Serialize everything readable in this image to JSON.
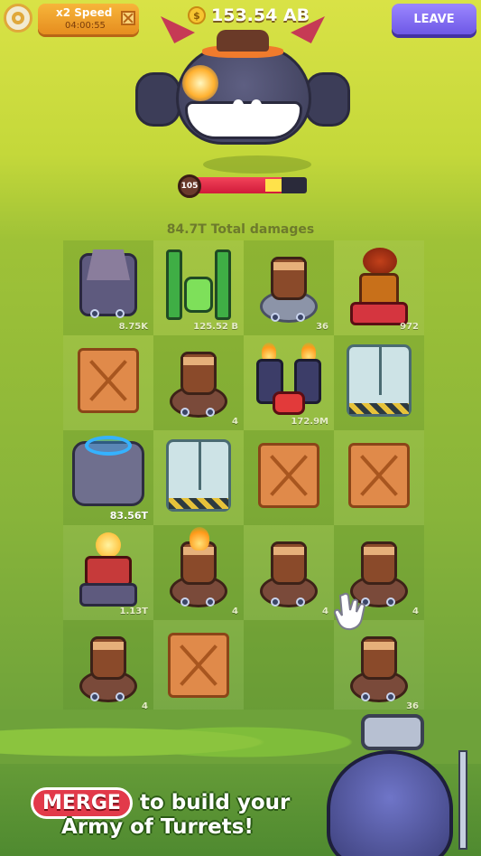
{
  "top_bar": {
    "settings_icon": "settings-gear-icon",
    "speed": {
      "title": "x2 Speed",
      "timer": "04:00:55"
    },
    "currency": {
      "coin_symbol": "$",
      "amount": "153.54 AB"
    },
    "leave_label": "LEAVE"
  },
  "boss": {
    "level": "105",
    "health_fraction": 0.78
  },
  "total_damages": "84.7T Total damages",
  "grid": {
    "rows": [
      [
        {
          "kind": "dark-mech",
          "level": "8.75K"
        },
        {
          "kind": "green-mech",
          "level": "125.52 B"
        },
        {
          "kind": "cannon-grey",
          "level": "36"
        },
        {
          "kind": "lava-mech",
          "level": "972"
        }
      ],
      [
        {
          "kind": "crate",
          "level": ""
        },
        {
          "kind": "cannon",
          "level": "4"
        },
        {
          "kind": "twin-mech",
          "level": "172.9M"
        },
        {
          "kind": "fridge",
          "level": ""
        }
      ],
      [
        {
          "kind": "portal-mech",
          "level": "83.56T"
        },
        {
          "kind": "fridge",
          "level": ""
        },
        {
          "kind": "crate",
          "level": ""
        },
        {
          "kind": "crate",
          "level": ""
        }
      ],
      [
        {
          "kind": "orb-mech",
          "level": "1.13T"
        },
        {
          "kind": "cannon-fire",
          "level": "4"
        },
        {
          "kind": "cannon",
          "level": "4"
        },
        {
          "kind": "cannon",
          "level": "4"
        }
      ],
      [
        {
          "kind": "cannon",
          "level": "4"
        },
        {
          "kind": "crate",
          "level": ""
        },
        {
          "kind": "empty",
          "level": ""
        },
        {
          "kind": "cannon",
          "level": "36"
        }
      ]
    ]
  },
  "promo": {
    "merge_word": "MERGE",
    "line1_rest": "to build your",
    "line2": "Army of Turrets!"
  },
  "colors": {
    "leave_button": "#7a64f0",
    "speed_box": "#f0a22e",
    "health_red": "#e22d48",
    "merge_pill": "#e23a4a"
  }
}
